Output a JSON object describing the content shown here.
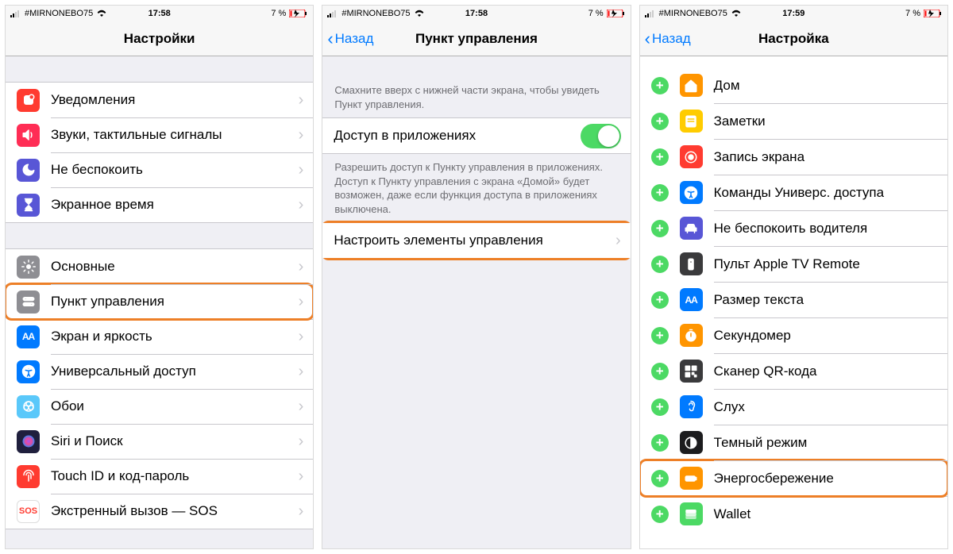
{
  "status": {
    "carrier": "#MIRNONEBO75",
    "batteryText": "7 %",
    "time1": "17:58",
    "time2": "17:58",
    "time3": "17:59"
  },
  "colors": {
    "red": "#ff3b30",
    "purple": "#5856d6",
    "blue": "#007aff",
    "grey": "#8e8e93",
    "orange": "#ff9500",
    "green": "#4cd964",
    "blueAlt": "#34aadc",
    "darkGrey": "#3a3a3c",
    "cyan": "#5ac8fa"
  },
  "screen1": {
    "title": "Настройки",
    "rows1": [
      {
        "label": "Уведомления",
        "color": "#ff3b30",
        "icon": "notifications"
      },
      {
        "label": "Звуки, тактильные сигналы",
        "color": "#ff2d55",
        "icon": "sounds"
      },
      {
        "label": "Не беспокоить",
        "color": "#5856d6",
        "icon": "moon"
      },
      {
        "label": "Экранное время",
        "color": "#5856d6",
        "icon": "hourglass"
      }
    ],
    "rows2": [
      {
        "label": "Основные",
        "color": "#8e8e93",
        "icon": "gear"
      },
      {
        "label": "Пункт управления",
        "color": "#8e8e93",
        "icon": "switches",
        "highlight": true
      },
      {
        "label": "Экран и яркость",
        "color": "#007aff",
        "icon": "text-size"
      },
      {
        "label": "Универсальный доступ",
        "color": "#007aff",
        "icon": "accessibility"
      },
      {
        "label": "Обои",
        "color": "#5ac8fa",
        "icon": "wallpaper"
      },
      {
        "label": "Siri и Поиск",
        "color": "#1f1f3d",
        "icon": "siri"
      },
      {
        "label": "Touch ID и код-пароль",
        "color": "#ff3b30",
        "icon": "fingerprint"
      },
      {
        "label": "Экстренный вызов — SOS",
        "color": "#ffffff",
        "icon": "sos"
      }
    ]
  },
  "screen2": {
    "back": "Назад",
    "title": "Пункт управления",
    "help1": "Смахните вверх с нижней части экрана, чтобы увидеть Пункт управления.",
    "row1": "Доступ в приложениях",
    "help2": "Разрешить доступ к Пункту управления в приложениях. Доступ к Пункту управления с экрана «Домой» будет возможен, даже если функция доступа в приложениях выключена.",
    "row2": "Настроить элементы управления"
  },
  "screen3": {
    "back": "Назад",
    "title": "Настройка",
    "rows": [
      {
        "label": "Дом",
        "color": "#ff9500",
        "icon": "home"
      },
      {
        "label": "Заметки",
        "color": "#ffcc00",
        "icon": "notes"
      },
      {
        "label": "Запись экрана",
        "color": "#ff3b30",
        "icon": "record"
      },
      {
        "label": "Команды Универс. доступа",
        "color": "#007aff",
        "icon": "accessibility"
      },
      {
        "label": "Не беспокоить водителя",
        "color": "#5856d6",
        "icon": "car"
      },
      {
        "label": "Пульт Apple TV Remote",
        "color": "#3a3a3c",
        "icon": "remote"
      },
      {
        "label": "Размер текста",
        "color": "#007aff",
        "icon": "text-size"
      },
      {
        "label": "Секундомер",
        "color": "#ff9500",
        "icon": "stopwatch"
      },
      {
        "label": "Сканер QR-кода",
        "color": "#3a3a3c",
        "icon": "qr"
      },
      {
        "label": "Слух",
        "color": "#007aff",
        "icon": "ear"
      },
      {
        "label": "Темный режим",
        "color": "#1c1c1e",
        "icon": "dark"
      },
      {
        "label": "Энергосбережение",
        "color": "#ff9500",
        "icon": "battery",
        "highlight": true
      },
      {
        "label": "Wallet",
        "color": "#4cd964",
        "icon": "wallet"
      }
    ]
  }
}
